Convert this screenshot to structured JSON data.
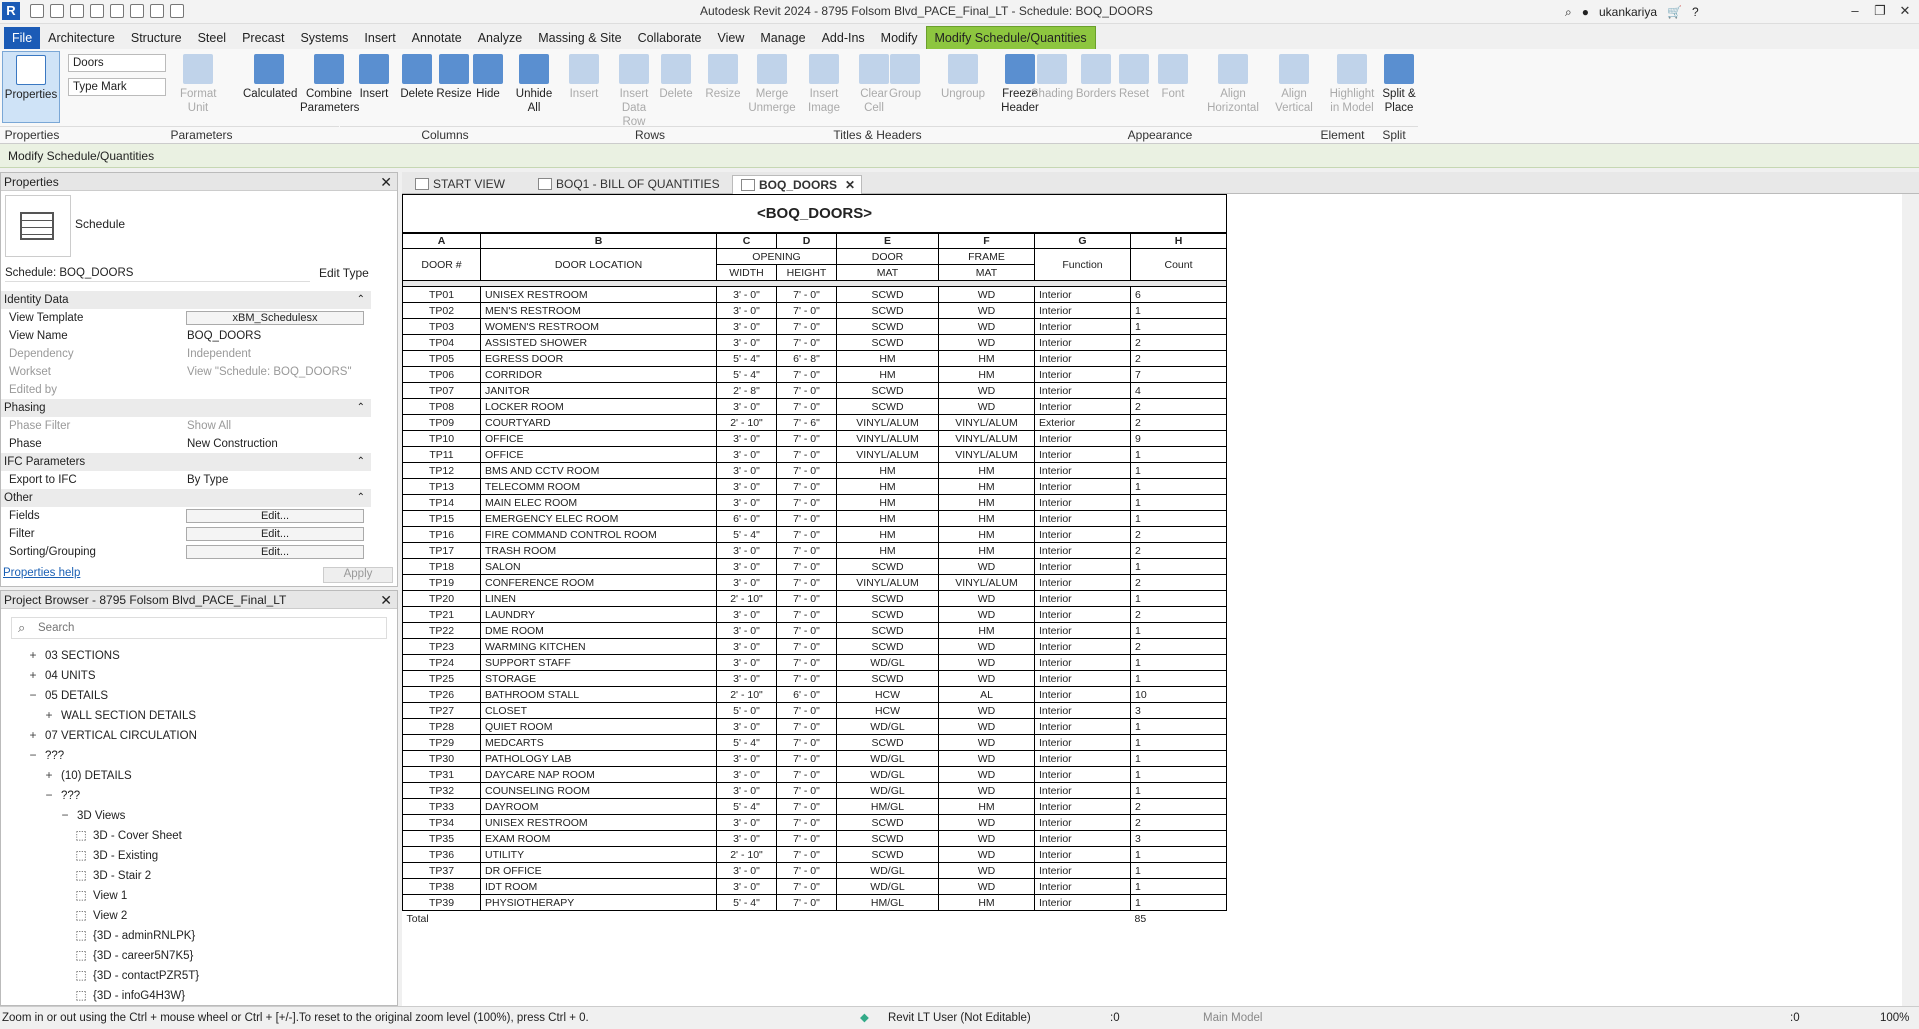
{
  "app": {
    "title": "Autodesk Revit 2024 - 8795 Folsom Blvd_PACE_Final_LT - Schedule: BOQ_DOORS",
    "user": "ukankariya",
    "logo": "R"
  },
  "menus": [
    "File",
    "Architecture",
    "Structure",
    "Steel",
    "Precast",
    "Systems",
    "Insert",
    "Annotate",
    "Analyze",
    "Massing & Site",
    "Collaborate",
    "View",
    "Manage",
    "Add-Ins",
    "Modify",
    "Modify Schedule/Quantities"
  ],
  "ribbon": {
    "properties_label": "Properties",
    "category_select": "Doors",
    "param_select": "Type Mark",
    "buttons": [
      "Format Unit",
      "Calculated",
      "Combine Parameters",
      "Insert",
      "Delete",
      "Resize",
      "Hide",
      "Unhide All",
      "Insert",
      "Insert Data Row",
      "Delete",
      "Resize",
      "Merge Unmerge",
      "Insert Image",
      "Clear Cell",
      "Group",
      "Ungroup",
      "Freeze Header",
      "Shading",
      "Borders",
      "Reset",
      "Font",
      "Align Horizontal",
      "Align Vertical",
      "Highlight in Model",
      "Split & Place"
    ],
    "groups": [
      "Properties",
      "Parameters",
      "Columns",
      "Rows",
      "Titles & Headers",
      "Appearance",
      "Element",
      "Split"
    ]
  },
  "context_bar": "Modify Schedule/Quantities",
  "properties": {
    "title": "Properties",
    "type": "Schedule",
    "instance": "Schedule: BOQ_DOORS",
    "edit_type": "Edit Type",
    "rows": [
      {
        "k": "Identity Data",
        "cat": true
      },
      {
        "k": "View Template",
        "v": "xBM_Schedulesx",
        "btn": true
      },
      {
        "k": "View Name",
        "v": "BOQ_DOORS"
      },
      {
        "k": "Dependency",
        "v": "Independent",
        "dim": true
      },
      {
        "k": "Workset",
        "v": "View \"Schedule: BOQ_DOORS\"",
        "dim": true
      },
      {
        "k": "Edited by",
        "v": "",
        "dim": true
      },
      {
        "k": "Phasing",
        "cat": true
      },
      {
        "k": "Phase Filter",
        "v": "Show All",
        "dim": true
      },
      {
        "k": "Phase",
        "v": "New Construction"
      },
      {
        "k": "IFC Parameters",
        "cat": true
      },
      {
        "k": "Export to IFC",
        "v": "By Type"
      },
      {
        "k": "Other",
        "cat": true
      },
      {
        "k": "Fields",
        "v": "Edit...",
        "btn": true
      },
      {
        "k": "Filter",
        "v": "Edit...",
        "btn": true
      },
      {
        "k": "Sorting/Grouping",
        "v": "Edit...",
        "btn": true
      }
    ],
    "help": "Properties help",
    "apply": "Apply"
  },
  "browser": {
    "title": "Project Browser - 8795 Folsom Blvd_PACE_Final_LT",
    "search_placeholder": "Search",
    "items": [
      {
        "t": "03 SECTIONS",
        "lvl": 1,
        "tg": "+"
      },
      {
        "t": "04 UNITS",
        "lvl": 1,
        "tg": "+"
      },
      {
        "t": "05 DETAILS",
        "lvl": 1,
        "tg": "−"
      },
      {
        "t": "WALL SECTION DETAILS",
        "lvl": 2,
        "tg": "+"
      },
      {
        "t": "07 VERTICAL CIRCULATION",
        "lvl": 1,
        "tg": "+"
      },
      {
        "t": "???",
        "lvl": 1,
        "tg": "−"
      },
      {
        "t": "(10) DETAILS",
        "lvl": 2,
        "tg": "+"
      },
      {
        "t": "???",
        "lvl": 2,
        "tg": "−"
      },
      {
        "t": "3D Views",
        "lvl": 3,
        "tg": "−"
      },
      {
        "t": "3D - Cover Sheet",
        "lvl": 4,
        "tg": ""
      },
      {
        "t": "3D - Existing",
        "lvl": 4,
        "tg": ""
      },
      {
        "t": "3D - Stair 2",
        "lvl": 4,
        "tg": ""
      },
      {
        "t": "View 1",
        "lvl": 4,
        "tg": ""
      },
      {
        "t": "View 2",
        "lvl": 4,
        "tg": ""
      },
      {
        "t": "{3D - adminRNLPK}",
        "lvl": 4,
        "tg": ""
      },
      {
        "t": "{3D - career5N7K5}",
        "lvl": 4,
        "tg": ""
      },
      {
        "t": "{3D - contactPZR5T}",
        "lvl": 4,
        "tg": ""
      },
      {
        "t": "{3D - infoG4H3W}",
        "lvl": 4,
        "tg": ""
      }
    ]
  },
  "tabs": [
    {
      "label": "START VIEW"
    },
    {
      "label": "BOQ1 - BILL OF QUANTITIES"
    },
    {
      "label": "BOQ_DOORS",
      "active": true
    }
  ],
  "schedule": {
    "title": "<BOQ_DOORS>",
    "letters": [
      "A",
      "B",
      "C",
      "D",
      "E",
      "F",
      "G",
      "H"
    ],
    "headers": {
      "door": "DOOR #",
      "loc": "DOOR LOCATION",
      "opening": "OPENING",
      "width": "WIDTH",
      "height": "HEIGHT",
      "door_top": "DOOR",
      "door_mat": "MAT",
      "frame_top": "FRAME",
      "frame_mat": "MAT",
      "function": "Function",
      "count": "Count"
    },
    "rows": [
      [
        "TP01",
        "UNISEX RESTROOM",
        "3' - 0\"",
        "7' - 0\"",
        "SCWD",
        "WD",
        "Interior",
        "6"
      ],
      [
        "TP02",
        "MEN'S RESTROOM",
        "3' - 0\"",
        "7' - 0\"",
        "SCWD",
        "WD",
        "Interior",
        "1"
      ],
      [
        "TP03",
        "WOMEN'S RESTROOM",
        "3' - 0\"",
        "7' - 0\"",
        "SCWD",
        "WD",
        "Interior",
        "1"
      ],
      [
        "TP04",
        "ASSISTED SHOWER",
        "3' - 0\"",
        "7' - 0\"",
        "SCWD",
        "WD",
        "Interior",
        "2"
      ],
      [
        "TP05",
        "EGRESS DOOR",
        "5' - 4\"",
        "6' - 8\"",
        "HM",
        "HM",
        "Interior",
        "2"
      ],
      [
        "TP06",
        "CORRIDOR",
        "5' - 4\"",
        "7' - 0\"",
        "HM",
        "HM",
        "Interior",
        "7"
      ],
      [
        "TP07",
        "JANITOR",
        "2' - 8\"",
        "7' - 0\"",
        "SCWD",
        "WD",
        "Interior",
        "4"
      ],
      [
        "TP08",
        "LOCKER ROOM",
        "3' - 0\"",
        "7' - 0\"",
        "SCWD",
        "WD",
        "Interior",
        "2"
      ],
      [
        "TP09",
        "COURTYARD",
        "2' - 10\"",
        "7' - 6\"",
        "VINYL/ALUM",
        "VINYL/ALUM",
        "Exterior",
        "2"
      ],
      [
        "TP10",
        "OFFICE",
        "3' - 0\"",
        "7' - 0\"",
        "VINYL/ALUM",
        "VINYL/ALUM",
        "Interior",
        "9"
      ],
      [
        "TP11",
        "OFFICE",
        "3' - 0\"",
        "7' - 0\"",
        "VINYL/ALUM",
        "VINYL/ALUM",
        "Interior",
        "1"
      ],
      [
        "TP12",
        "BMS AND CCTV ROOM",
        "3' - 0\"",
        "7' - 0\"",
        "HM",
        "HM",
        "Interior",
        "1"
      ],
      [
        "TP13",
        "TELECOMM ROOM",
        "3' - 0\"",
        "7' - 0\"",
        "HM",
        "HM",
        "Interior",
        "1"
      ],
      [
        "TP14",
        "MAIN ELEC ROOM",
        "3' - 0\"",
        "7' - 0\"",
        "HM",
        "HM",
        "Interior",
        "1"
      ],
      [
        "TP15",
        "EMERGENCY ELEC ROOM",
        "6' - 0\"",
        "7' - 0\"",
        "HM",
        "HM",
        "Interior",
        "1"
      ],
      [
        "TP16",
        "FIRE COMMAND CONTROL ROOM",
        "5' - 4\"",
        "7' - 0\"",
        "HM",
        "HM",
        "Interior",
        "2"
      ],
      [
        "TP17",
        "TRASH ROOM",
        "3' - 0\"",
        "7' - 0\"",
        "HM",
        "HM",
        "Interior",
        "2"
      ],
      [
        "TP18",
        "SALON",
        "3' - 0\"",
        "7' - 0\"",
        "SCWD",
        "WD",
        "Interior",
        "1"
      ],
      [
        "TP19",
        "CONFERENCE ROOM",
        "3' - 0\"",
        "7' - 0\"",
        "VINYL/ALUM",
        "VINYL/ALUM",
        "Interior",
        "2"
      ],
      [
        "TP20",
        "LINEN",
        "2' - 10\"",
        "7' - 0\"",
        "SCWD",
        "WD",
        "Interior",
        "1"
      ],
      [
        "TP21",
        "LAUNDRY",
        "3' - 0\"",
        "7' - 0\"",
        "SCWD",
        "WD",
        "Interior",
        "2"
      ],
      [
        "TP22",
        "DME ROOM",
        "3' - 0\"",
        "7' - 0\"",
        "SCWD",
        "HM",
        "Interior",
        "1"
      ],
      [
        "TP23",
        "WARMING KITCHEN",
        "3' - 0\"",
        "7' - 0\"",
        "SCWD",
        "WD",
        "Interior",
        "2"
      ],
      [
        "TP24",
        "SUPPORT STAFF",
        "3' - 0\"",
        "7' - 0\"",
        "WD/GL",
        "WD",
        "Interior",
        "1"
      ],
      [
        "TP25",
        "STORAGE",
        "3' - 0\"",
        "7' - 0\"",
        "SCWD",
        "WD",
        "Interior",
        "1"
      ],
      [
        "TP26",
        "BATHROOM STALL",
        "2' - 10\"",
        "6' - 0\"",
        "HCW",
        "AL",
        "Interior",
        "10"
      ],
      [
        "TP27",
        "CLOSET",
        "5' - 0\"",
        "7' - 0\"",
        "HCW",
        "WD",
        "Interior",
        "3"
      ],
      [
        "TP28",
        "QUIET ROOM",
        "3' - 0\"",
        "7' - 0\"",
        "WD/GL",
        "WD",
        "Interior",
        "1"
      ],
      [
        "TP29",
        "MEDCARTS",
        "5' - 4\"",
        "7' - 0\"",
        "SCWD",
        "WD",
        "Interior",
        "1"
      ],
      [
        "TP30",
        "PATHOLOGY LAB",
        "3' - 0\"",
        "7' - 0\"",
        "WD/GL",
        "WD",
        "Interior",
        "1"
      ],
      [
        "TP31",
        "DAYCARE NAP ROOM",
        "3' - 0\"",
        "7' - 0\"",
        "WD/GL",
        "WD",
        "Interior",
        "1"
      ],
      [
        "TP32",
        "COUNSELING ROOM",
        "3' - 0\"",
        "7' - 0\"",
        "WD/GL",
        "WD",
        "Interior",
        "1"
      ],
      [
        "TP33",
        "DAYROOM",
        "5' - 4\"",
        "7' - 0\"",
        "HM/GL",
        "HM",
        "Interior",
        "2"
      ],
      [
        "TP34",
        "UNISEX RESTROOM",
        "3' - 0\"",
        "7' - 0\"",
        "SCWD",
        "WD",
        "Interior",
        "2"
      ],
      [
        "TP35",
        "EXAM ROOM",
        "3' - 0\"",
        "7' - 0\"",
        "SCWD",
        "WD",
        "Interior",
        "3"
      ],
      [
        "TP36",
        "UTILITY",
        "2' - 10\"",
        "7' - 0\"",
        "SCWD",
        "WD",
        "Interior",
        "1"
      ],
      [
        "TP37",
        "DR OFFICE",
        "3' - 0\"",
        "7' - 0\"",
        "WD/GL",
        "WD",
        "Interior",
        "1"
      ],
      [
        "TP38",
        "IDT ROOM",
        "3' - 0\"",
        "7' - 0\"",
        "WD/GL",
        "WD",
        "Interior",
        "1"
      ],
      [
        "TP39",
        "PHYSIOTHERAPY",
        "5' - 4\"",
        "7' - 0\"",
        "HM/GL",
        "HM",
        "Interior",
        "1"
      ]
    ],
    "total_label": "Total",
    "total_count": "85"
  },
  "status": {
    "hint": "Zoom in or out using the Ctrl + mouse wheel or Ctrl + [+/-].To reset to the original zoom level (100%), press Ctrl + 0.",
    "user": "Revit LT User (Not Editable)",
    "sel": ":0",
    "model": "Main Model",
    "filter": ":0",
    "zoom": "100%"
  }
}
